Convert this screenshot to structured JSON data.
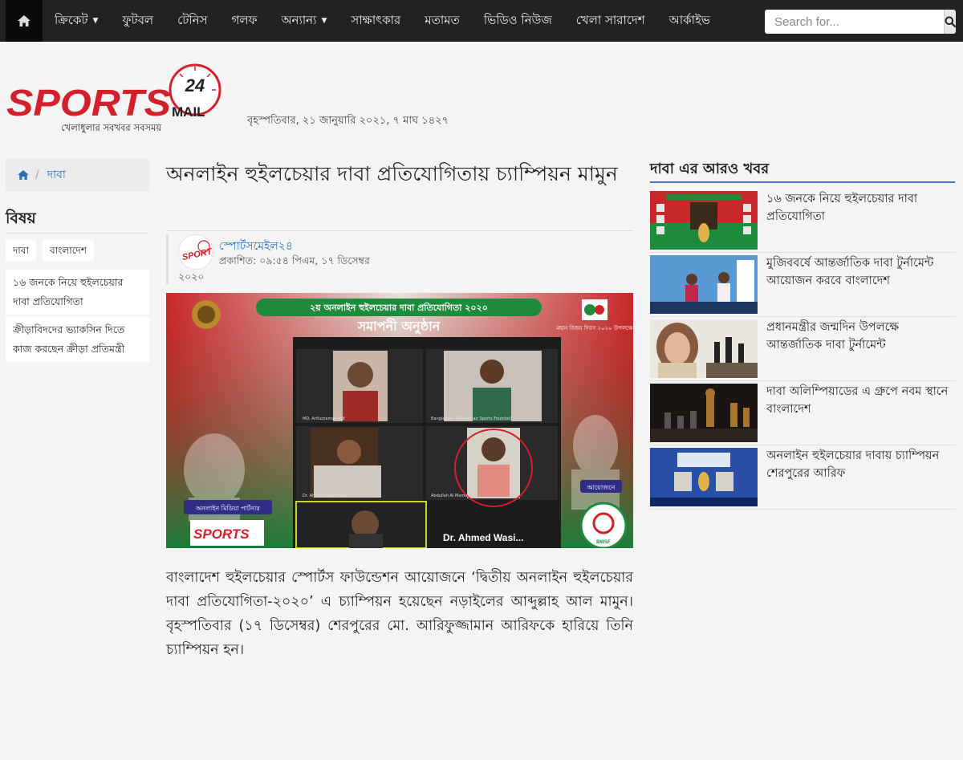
{
  "nav": {
    "items": [
      {
        "label": "ক্রিকেট",
        "dropdown": true
      },
      {
        "label": "ফুটবল",
        "dropdown": false
      },
      {
        "label": "টেনিস",
        "dropdown": false
      },
      {
        "label": "গলফ",
        "dropdown": false
      },
      {
        "label": "অন্যান্য",
        "dropdown": true
      },
      {
        "label": "সাক্ষাৎকার",
        "dropdown": false
      },
      {
        "label": "মতামত",
        "dropdown": false
      },
      {
        "label": "ভিডিও নিউজ",
        "dropdown": false
      },
      {
        "label": "খেলা সারাদেশ",
        "dropdown": false
      },
      {
        "label": "আর্কাইভ",
        "dropdown": false
      }
    ],
    "search_placeholder": "Search for..."
  },
  "header": {
    "logo_text": "SPORTS",
    "logo_mail": "MAIL",
    "logo_number": "24",
    "logo_tagline": "খেলাধুলার সবখবর সবসময়",
    "date": "বৃহস্পতিবার, ২১ জানুয়ারি ২০২১, ৭ মাঘ ১৪২৭"
  },
  "breadcrumb": {
    "current": "দাবা"
  },
  "left": {
    "section_title": "বিষয়",
    "tags": [
      "দাবা",
      "বাংলাদেশ"
    ],
    "related": [
      "১৬ জনকে নিয়ে হুইলচেয়ার দাবা প্রতিযোগিতা",
      "ক্রীড়াবিদদের ভ্যাকসিন দিতে কাজ করছেন ক্রীড়া প্রতিমন্ত্রী"
    ]
  },
  "article": {
    "headline": "অনলাইন হুইলচেয়ার দাবা প্রতিযোগিতায় চ্যাম্পিয়ন মামুন",
    "author": "স্পোর্টসমেইল২৪",
    "published": "প্রকাশিত: ০৯:৫৪ পিএম, ১৭ ডিসেম্বর",
    "published_year": "২০২০",
    "image": {
      "banner_title": "২য় অনলাইন হুইলচেয়ার দাবা প্রতিযোগিতা ২০২০",
      "subtitle": "সমাপনী অনুষ্ঠান",
      "right_badge": "মহান বিজয় দিবস ২০২০ উপলক্ষে",
      "participants": [
        "MD. Arifuzzaman Arif",
        "Bangladesh Wheelchair Sports Foundati...",
        "Dr. Ahmed Wasif Hasan",
        "Abdullah Al Mamun"
      ],
      "speaker": "Dr. Ahmed Wasi...",
      "media_partner": "অনলাইন মিডিয়া পার্টনার",
      "organizer": "আয়োজনে",
      "bwsf": "BWSF"
    },
    "body": "বাংলাদেশ হুইলচেয়ার স্পোর্টস ফাউন্ডেশন আয়োজনে ‘দ্বিতীয় অনলাইন হুইলচেয়ার দাবা প্রতিযোগিতা-২০২০’ এ চ্যাম্পিয়ন হয়েছেন নড়াইলের আব্দুল্লাহ আল মামুন। বৃহস্পতিবার (১৭ ডিসেম্বর) শেরপুরের মো. আরিফুজ্জামান আরিফকে হারিয়ে তিনি চ্যাম্পিয়ন হন।"
  },
  "right": {
    "title": "দাবা এর আরও খবর",
    "items": [
      {
        "title": "১৬ জনকে নিয়ে হুইলচেয়ার দাবা প্রতিযোগিতা",
        "thumb": "tournament-poster"
      },
      {
        "title": "মুজিববর্ষে আন্তর্জাতিক দাবা টুর্নামেন্ট আয়োজন করবে বাংলাদেশ",
        "thumb": "press-conference"
      },
      {
        "title": "প্রধানমন্ত্রীর জন্মদিন উপলক্ষে আন্তর্জাতিক দাবা টুর্নামেন্ট",
        "thumb": "prime-minister-chess"
      },
      {
        "title": "দাবা অলিম্পিয়াডের এ গ্রুপে নবম স্থানে বাংলাদেশ",
        "thumb": "chess-pieces"
      },
      {
        "title": "অনলাইন হুইলচেয়ার দাবায় চ্যাম্পিয়ন শেরপুরের আরিফ",
        "thumb": "online-champion"
      }
    ]
  },
  "colors": {
    "nav_bg": "#222222",
    "logo_red": "#d3202a",
    "link_blue": "#2a6db5",
    "accent_rule": "#4a74c4",
    "banner_green": "#1e8a3c"
  }
}
